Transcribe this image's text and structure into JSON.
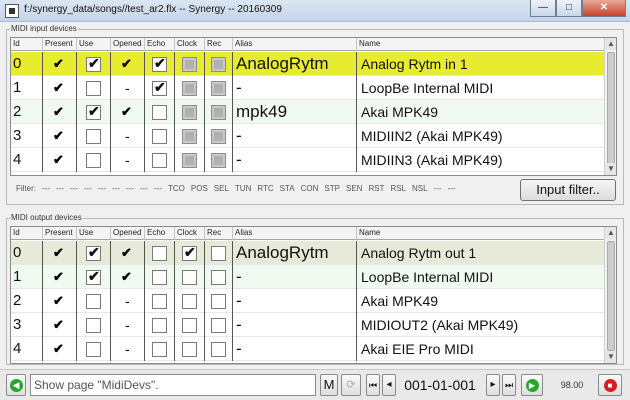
{
  "window": {
    "title": "f:/synergy_data/songs//test_ar2.flx -- Synergy -- 20160309",
    "minimize": "—",
    "maximize": "□",
    "close": "✕"
  },
  "input": {
    "group_label": "MIDI input devices",
    "columns": [
      "Id",
      "Present",
      "Use",
      "Opened",
      "Echo",
      "Clock",
      "Rec",
      "Alias",
      "Name"
    ],
    "rows": [
      {
        "id": "0",
        "present": "✔",
        "use": true,
        "opened": "✔",
        "echo": true,
        "clock": "dis",
        "rec": "dis",
        "alias": "AnalogRytm",
        "name": "Analog Rytm in 1",
        "bg": "#e8ec2e"
      },
      {
        "id": "1",
        "present": "✔",
        "use": false,
        "opened": "-",
        "echo": true,
        "clock": "dis",
        "rec": "dis",
        "alias": "-",
        "name": "LoopBe Internal MIDI",
        "bg": "#ffffff"
      },
      {
        "id": "2",
        "present": "✔",
        "use": true,
        "opened": "✔",
        "echo": false,
        "clock": "dis",
        "rec": "dis",
        "alias": "mpk49",
        "name": "Akai MPK49",
        "bg": "#f1faf1"
      },
      {
        "id": "3",
        "present": "✔",
        "use": false,
        "opened": "-",
        "echo": false,
        "clock": "dis",
        "rec": "dis",
        "alias": "-",
        "name": "MIDIIN2 (Akai MPK49)",
        "bg": "#ffffff"
      },
      {
        "id": "4",
        "present": "✔",
        "use": false,
        "opened": "-",
        "echo": false,
        "clock": "dis",
        "rec": "dis",
        "alias": "-",
        "name": "MIDIIN3 (Akai MPK49)",
        "bg": "#ffffff"
      }
    ]
  },
  "filter": {
    "label": "Filter:",
    "items": [
      "---",
      "---",
      "---",
      "---",
      "---",
      "---",
      "---",
      "---",
      "---",
      "TCO",
      "POS",
      "SEL",
      "TUN",
      "RTC",
      "STA",
      "CON",
      "STP",
      "SEN",
      "RST",
      "RSL",
      "NSL",
      "---",
      "---"
    ],
    "button": "Input filter.."
  },
  "output": {
    "group_label": "MIDI output devices",
    "columns": [
      "Id",
      "Present",
      "Use",
      "Opened",
      "Echo",
      "Clock",
      "Rec",
      "Alias",
      "Name"
    ],
    "rows": [
      {
        "id": "0",
        "present": "✔",
        "use": true,
        "opened": "✔",
        "echo": false,
        "clock": "on",
        "rec": "off",
        "alias": "AnalogRytm",
        "name": "Analog Rytm out 1",
        "bg": "#e6ead8"
      },
      {
        "id": "1",
        "present": "✔",
        "use": true,
        "opened": "✔",
        "echo": false,
        "clock": "off",
        "rec": "off",
        "alias": "-",
        "name": "LoopBe Internal MIDI",
        "bg": "#f1faf1"
      },
      {
        "id": "2",
        "present": "✔",
        "use": false,
        "opened": "-",
        "echo": false,
        "clock": "off",
        "rec": "off",
        "alias": "-",
        "name": "Akai MPK49",
        "bg": "#ffffff"
      },
      {
        "id": "3",
        "present": "✔",
        "use": false,
        "opened": "-",
        "echo": false,
        "clock": "off",
        "rec": "off",
        "alias": "-",
        "name": "MIDIOUT2 (Akai MPK49)",
        "bg": "#ffffff"
      },
      {
        "id": "4",
        "present": "✔",
        "use": false,
        "opened": "-",
        "echo": false,
        "clock": "off",
        "rec": "off",
        "alias": "-",
        "name": "Akai EIE Pro MIDI",
        "bg": "#ffffff"
      }
    ]
  },
  "statusbar": {
    "command_value": "Show page \"MidiDevs\".",
    "m_button": "M",
    "prev_button": "◂",
    "position": "001-01-001",
    "next_button": "▸",
    "tempo": "98.00",
    "first_button": "⏮",
    "last_button": "⏭"
  },
  "colors": {
    "highlight_yellow": "#e8ec2e",
    "play_green": "#2ca52c",
    "stop_red": "#d42020"
  }
}
